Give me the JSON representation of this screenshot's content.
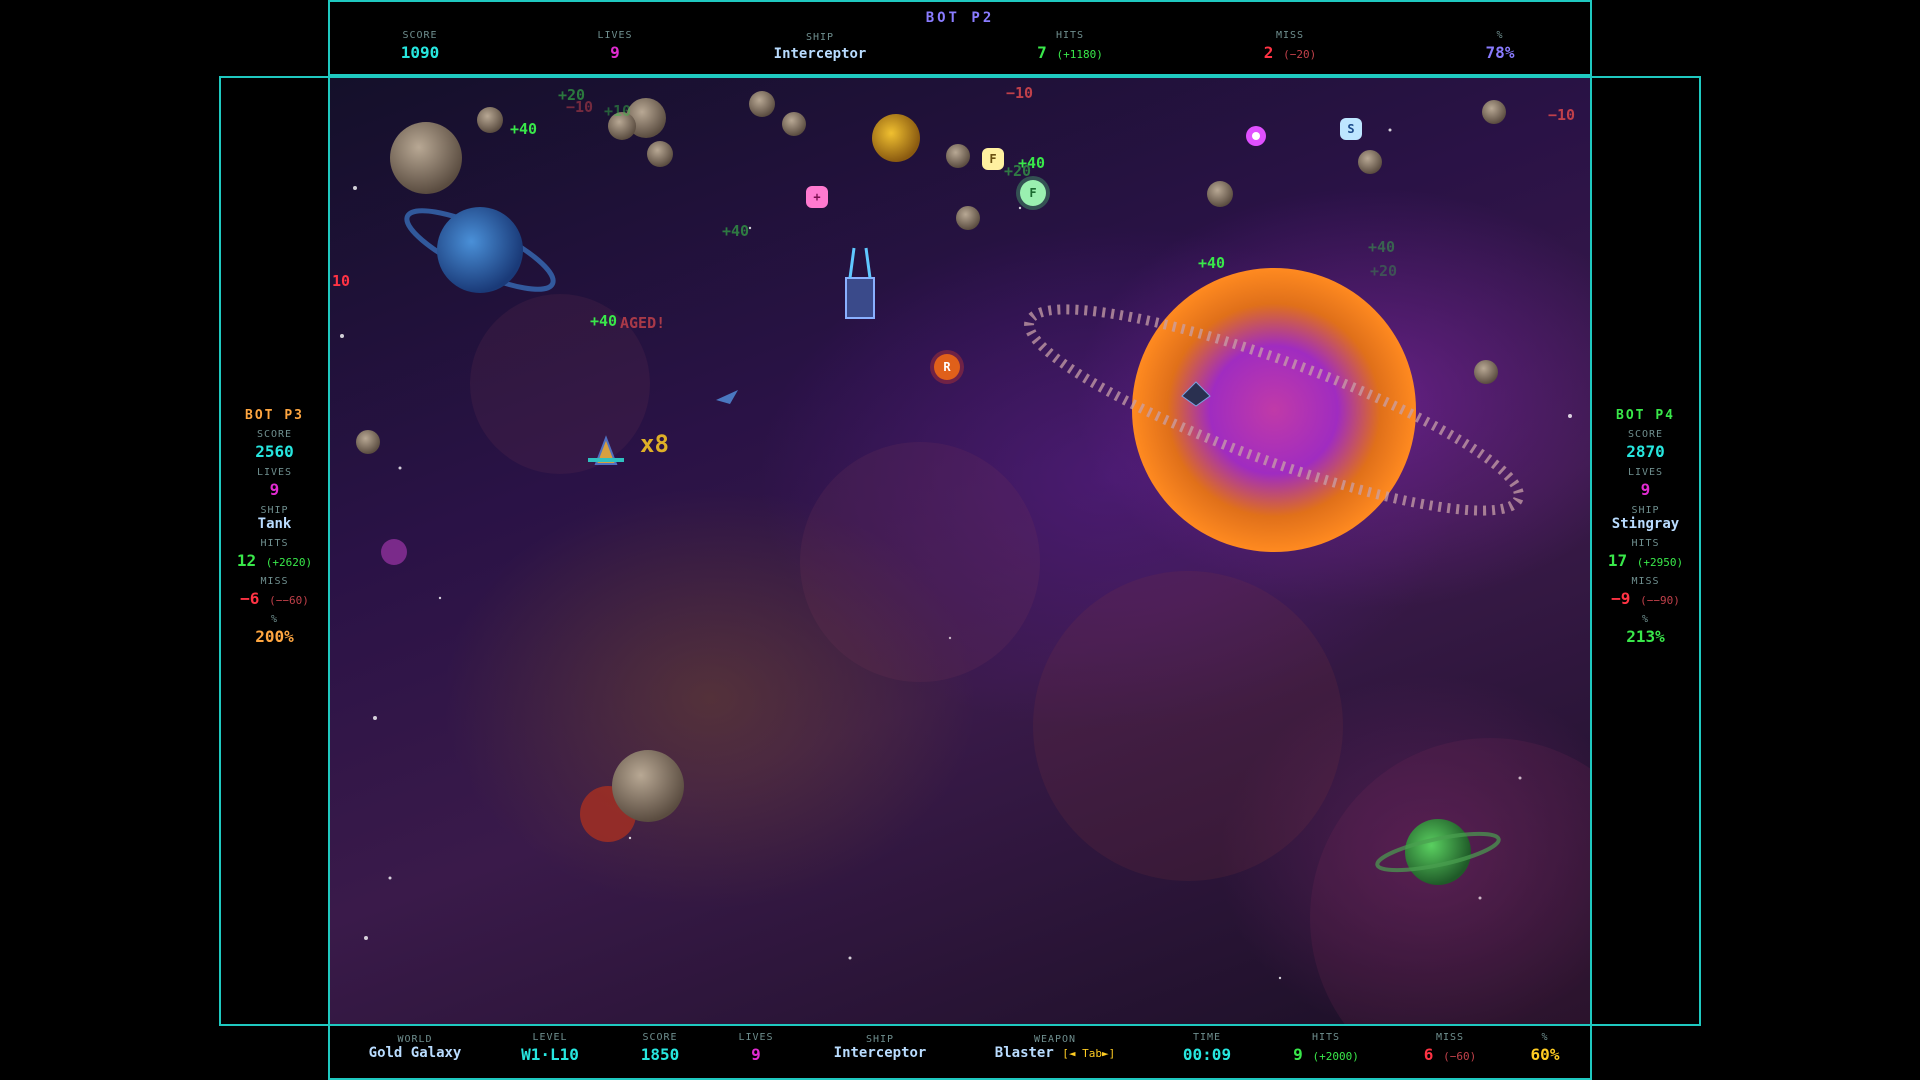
{
  "top": {
    "title": "BOT P2",
    "score_label": "SCORE",
    "score": "1090",
    "lives_label": "LIVES",
    "lives": "9",
    "ship_label": "SHIP",
    "ship": "Interceptor",
    "hits_label": "HITS",
    "hits": "7",
    "hits_bonus": "(+1180)",
    "miss_label": "MISS",
    "miss": "2",
    "miss_penalty": "(−20)",
    "pct_label": "%",
    "pct": "78%"
  },
  "left": {
    "title": "BOT P3",
    "score_label": "SCORE",
    "score": "2560",
    "lives_label": "LIVES",
    "lives": "9",
    "ship_label": "SHIP",
    "ship": "Tank",
    "hits_label": "HITS",
    "hits": "12",
    "hits_bonus": "(+2620)",
    "miss_label": "MISS",
    "miss": "−6",
    "miss_penalty": "(−−60)",
    "pct_label": "%",
    "pct": "200%"
  },
  "right": {
    "title": "BOT P4",
    "score_label": "SCORE",
    "score": "2870",
    "lives_label": "LIVES",
    "lives": "9",
    "ship_label": "SHIP",
    "ship": "Stingray",
    "hits_label": "HITS",
    "hits": "17",
    "hits_bonus": "(+2950)",
    "miss_label": "MISS",
    "miss": "−9",
    "miss_penalty": "(−−90)",
    "pct_label": "%",
    "pct": "213%"
  },
  "bottom": {
    "world_label": "WORLD",
    "world": "Gold Galaxy",
    "level_label": "LEVEL",
    "level": "W1·L10",
    "score_label": "SCORE",
    "score": "1850",
    "lives_label": "LIVES",
    "lives": "9",
    "ship_label": "SHIP",
    "ship": "Interceptor",
    "weapon_label": "WEAPON",
    "weapon": "Blaster",
    "weapon_hint": "[◄ Tab►]",
    "time_label": "TIME",
    "time": "00:09",
    "hits_label": "HITS",
    "hits": "9",
    "hits_bonus": "(+2000)",
    "miss_label": "MISS",
    "miss": "6",
    "miss_penalty": "(−60)",
    "pct_label": "%",
    "pct": "60%"
  },
  "playfield": {
    "combo": "x8",
    "damaged": "AGED!",
    "floats": [
      "+20",
      "+40",
      "−10",
      "+10",
      "−10",
      "−10",
      "+40",
      "+40",
      "+40",
      "+40",
      "+20",
      "+40",
      "10",
      "+20"
    ],
    "powerups": [
      "S",
      "F",
      "R",
      "+",
      "F"
    ]
  }
}
